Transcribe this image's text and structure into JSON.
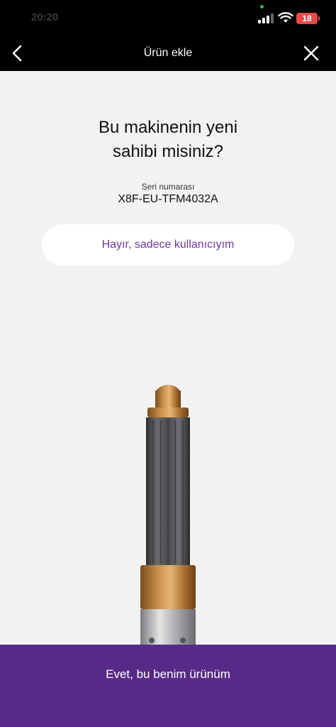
{
  "status_bar": {
    "time": "20:20",
    "battery_level": "18",
    "battery_color": "#e84a4a"
  },
  "header": {
    "title": "Ürün ekle",
    "back_icon": "chevron-left-icon",
    "close_icon": "close-icon"
  },
  "main": {
    "question": "Bu makinenin yeni\nsahibi misiniz?",
    "serial_label": "Seri numarası",
    "serial_value": "X8F-EU-TFM4032A",
    "secondary_button_label": "Hayır, sadece kullanıcıyım",
    "product_image": "hair-styler-attachment"
  },
  "footer": {
    "primary_button_label": "Evet, bu benim ürünüm"
  },
  "colors": {
    "accent": "#572a88",
    "accent_text": "#6b35a6",
    "header_bg": "#000000",
    "page_bg": "#f2f2f2"
  }
}
